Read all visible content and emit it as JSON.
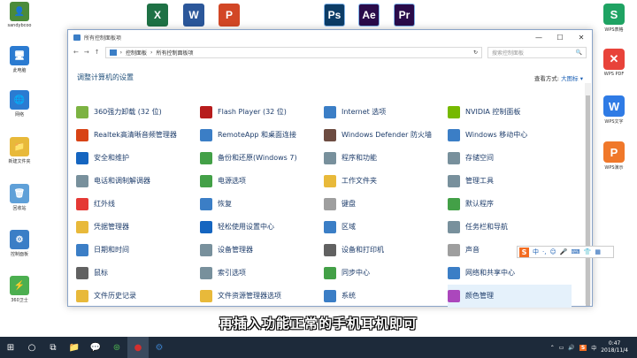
{
  "desktop": {
    "left_icons": [
      {
        "label": "sandybcoo",
        "color": "#4b8b3b",
        "glyph": "👤"
      },
      {
        "label": "此电脑",
        "color": "#2b7bd1",
        "glyph": "🖥"
      },
      {
        "label": "网络",
        "color": "#2b7bd1",
        "glyph": "🌐"
      },
      {
        "label": "新建文件夹",
        "color": "#e8b93a",
        "glyph": "📁"
      },
      {
        "label": "回收站",
        "color": "#5fa0d8",
        "glyph": "🗑"
      },
      {
        "label": "控制面板",
        "color": "#3b7ec6",
        "glyph": "⚙"
      },
      {
        "label": "360卫士",
        "color": "#4caf50",
        "glyph": "⚡"
      }
    ],
    "top_icons": [
      {
        "glyph": "X",
        "color": "#1e7145"
      },
      {
        "glyph": "W",
        "color": "#2b579a"
      },
      {
        "glyph": "P",
        "color": "#d24726"
      },
      {
        "glyph": "Ps",
        "color": "#0c3c66"
      },
      {
        "glyph": "Ae",
        "color": "#2a0b4a"
      },
      {
        "glyph": "Pr",
        "color": "#2a0b4a"
      }
    ],
    "right_apps": [
      {
        "label": "WPS表格",
        "glyph": "S",
        "color": "#1fa363"
      },
      {
        "label": "WPS PDF",
        "glyph": "✕",
        "color": "#e8433a"
      },
      {
        "label": "WPS文字",
        "glyph": "W",
        "color": "#2f7be5"
      },
      {
        "label": "WPS演示",
        "glyph": "P",
        "color": "#f0782a"
      }
    ]
  },
  "window": {
    "title": "所有控制面板项",
    "controls": {
      "minimize": "—",
      "maximize": "☐",
      "close": "✕"
    },
    "address": {
      "back": "←",
      "forward": "→",
      "up": "↑",
      "crumbs": [
        "控制面板",
        "所有控制面板项"
      ],
      "sep": "›",
      "refresh": "↻"
    },
    "search": {
      "placeholder": "搜索控制面板",
      "icon": "🔍"
    },
    "heading": "调整计算机的设置",
    "view_by_label": "查看方式:",
    "view_by_value": "大图标 ▾",
    "items": [
      {
        "label": "360强力卸载 (32 位)",
        "color": "#7cb342"
      },
      {
        "label": "Flash Player (32 位)",
        "color": "#b71c1c"
      },
      {
        "label": "Internet 选项",
        "color": "#3b7ec6"
      },
      {
        "label": "NVIDIA 控制面板",
        "color": "#76b900"
      },
      {
        "label": "Realtek高清晰音频管理器",
        "color": "#d84315"
      },
      {
        "label": "RemoteApp 和桌面连接",
        "color": "#3b7ec6"
      },
      {
        "label": "Windows Defender 防火墙",
        "color": "#6d4c41"
      },
      {
        "label": "Windows 移动中心",
        "color": "#3b7ec6"
      },
      {
        "label": "安全和维护",
        "color": "#1565c0"
      },
      {
        "label": "备份和还原(Windows 7)",
        "color": "#43a047"
      },
      {
        "label": "程序和功能",
        "color": "#78909c"
      },
      {
        "label": "存储空间",
        "color": "#78909c"
      },
      {
        "label": "电话和调制解调器",
        "color": "#78909c"
      },
      {
        "label": "电源选项",
        "color": "#43a047"
      },
      {
        "label": "工作文件夹",
        "color": "#e8b93a"
      },
      {
        "label": "管理工具",
        "color": "#78909c"
      },
      {
        "label": "红外线",
        "color": "#e53935"
      },
      {
        "label": "恢复",
        "color": "#3b7ec6"
      },
      {
        "label": "键盘",
        "color": "#9e9e9e"
      },
      {
        "label": "默认程序",
        "color": "#43a047"
      },
      {
        "label": "凭据管理器",
        "color": "#e8b93a"
      },
      {
        "label": "轻松使用设置中心",
        "color": "#1565c0"
      },
      {
        "label": "区域",
        "color": "#3b7ec6"
      },
      {
        "label": "任务栏和导航",
        "color": "#78909c"
      },
      {
        "label": "日期和时间",
        "color": "#3b7ec6"
      },
      {
        "label": "设备管理器",
        "color": "#78909c"
      },
      {
        "label": "设备和打印机",
        "color": "#616161"
      },
      {
        "label": "声音",
        "color": "#9e9e9e"
      },
      {
        "label": "鼠标",
        "color": "#616161"
      },
      {
        "label": "索引选项",
        "color": "#78909c"
      },
      {
        "label": "同步中心",
        "color": "#43a047"
      },
      {
        "label": "网络和共享中心",
        "color": "#3b7ec6"
      },
      {
        "label": "文件历史记录",
        "color": "#e8b93a"
      },
      {
        "label": "文件资源管理器选项",
        "color": "#e8b93a"
      },
      {
        "label": "系统",
        "color": "#3b7ec6"
      },
      {
        "label": "颜色管理",
        "color": "#ab47bc"
      }
    ]
  },
  "ime": {
    "logo": "S",
    "items": [
      "中",
      "·,",
      "☺",
      "🎤",
      "⌨",
      "👕",
      "▦"
    ]
  },
  "subtitle": "再插入功能正常的手机耳机即可",
  "taskbar": {
    "start": "⊞",
    "search": "○",
    "taskview": "⧉",
    "apps": [
      {
        "glyph": "📁",
        "color": "#e8b93a"
      },
      {
        "glyph": "💬",
        "color": "#2dc100"
      },
      {
        "glyph": "⊛",
        "color": "#4caf50"
      },
      {
        "glyph": "●",
        "color": "#d32f2f"
      },
      {
        "glyph": "⚙",
        "color": "#3b7ec6"
      }
    ],
    "tray": {
      "icons": [
        "⌃",
        "▭",
        "🔊",
        "S",
        "中"
      ],
      "time": "0:47",
      "date": "2018/11/4"
    }
  }
}
